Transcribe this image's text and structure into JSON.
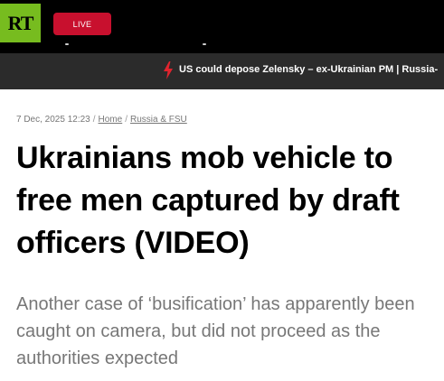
{
  "header": {
    "logo_text": "RT",
    "live_label": "LIVE",
    "brand_color": "#77bc1f",
    "live_color": "#c8102e"
  },
  "ticker": {
    "icon": "lightning-bolt-icon",
    "text": "US could depose Zelensky – ex-Ukrainian PM | Russia-"
  },
  "article": {
    "timestamp": "7 Dec, 2025 12:23",
    "breadcrumb": {
      "home": "Home",
      "section": "Russia & FSU"
    },
    "title": "Ukrainians mob vehicle to free men captured by draft officers (VIDEO)",
    "lead": "Another case of ‘busification’ has apparently been caught on camera, but did not proceed as the authorities expected"
  }
}
